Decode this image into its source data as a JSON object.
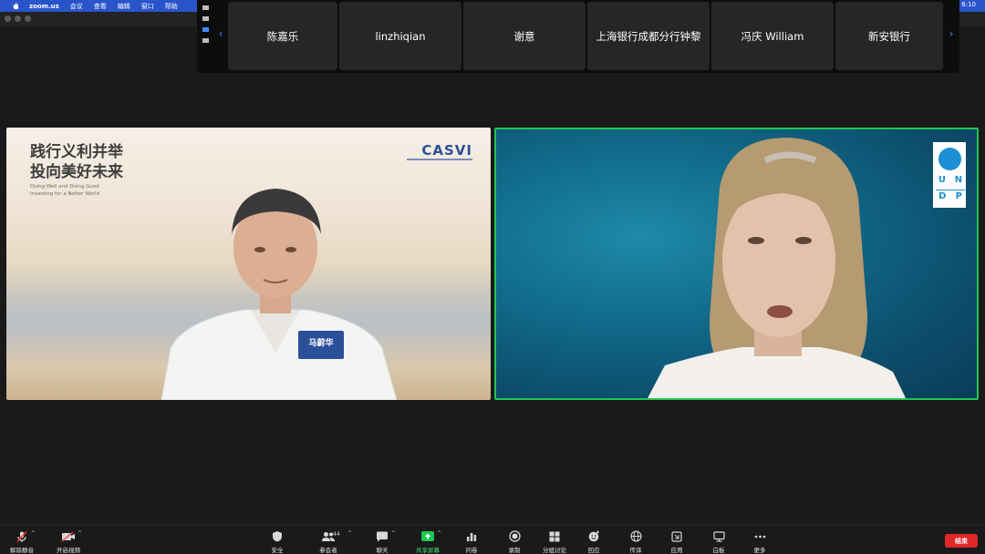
{
  "menubar": {
    "app_name": "zoom.us",
    "items": [
      "会议",
      "查看",
      "编辑",
      "窗口",
      "帮助"
    ],
    "clock": "6:10"
  },
  "strip": {
    "participants": [
      "陈嘉乐",
      "linzhiqian",
      "谢意",
      "上海银行成都分行钟黎",
      "冯庆 William",
      "新安银行"
    ]
  },
  "left_video": {
    "headline_line1": "践行义利并举",
    "headline_line2": "投向美好未来",
    "subline1": "Doing Well and Doing Good",
    "subline2": "Investing for a Better World",
    "org_logo_text": "CASVI",
    "name_badge": "马蔚华"
  },
  "right_video": {
    "logo_line1": [
      "U",
      "N"
    ],
    "logo_line2": [
      "D",
      "P"
    ]
  },
  "toolbar": {
    "unmute": "解除静音",
    "start_video": "开启视频",
    "security": "安全",
    "participants": "参会者",
    "participants_count": "44",
    "chat": "聊天",
    "share_screen": "共享屏幕",
    "polls": "问卷",
    "record": "录制",
    "breakout": "分组讨论",
    "reactions": "回应",
    "interpret": "传译",
    "apps": "应用",
    "whiteboard": "白板",
    "more": "更多",
    "end": "结束"
  },
  "colors": {
    "menubar": "#2a54c9",
    "active_speaker": "#23c552",
    "share_green": "#18c950",
    "end_red": "#e02828",
    "accent_blue": "#3d8bff"
  }
}
